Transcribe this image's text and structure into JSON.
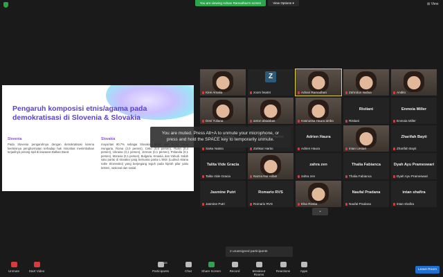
{
  "topbar": {
    "banner": "You are viewing Adnan Ramadhan's screen",
    "view_options": "View Options ▾",
    "view_button": "⊞ View"
  },
  "slide": {
    "title": "Pengaruh komposisi etnis/agama pada demokratisasi di Slovenia & Slovakia",
    "left_heading": "Slovenia",
    "left_text": "Pada Slovenia pengaruhnya dengan demokratisasi karena keetnisnya penghormatan terhadap hak minoritas menimbulkan terjadinya perang sipil di kawasan Balkan Barat.",
    "right_heading": "Slovakia",
    "right_text": "mayoritas 80,7% sebagai Slovakia, terdiri dari 9,7% orang Hungaria, Roma (2,0 persen), Ceko (0,6 persen), Rusin (0,4 persen), Ukraina (0,1 persen), Jerman (0,1 persen), Polandia (0,1 persen), Moravia (0,1 persen), Bulgaria, Kroasia, dan Yahudi. Salah satu partai di slovakia yang bernama partai L'SNS (Ludová strana naše Slovensko) yang berpegang teguh pada kiprah pilar yaitu kristen, nasional dan sosial."
  },
  "participants": [
    {
      "name": "Kirei Amalia",
      "kind": "video"
    },
    {
      "name": "zoom bsa04",
      "kind": "avatar",
      "avatar_letter": "Z"
    },
    {
      "name": "Adnan Ramadhan",
      "kind": "video",
      "active": true
    },
    {
      "name": "Zahrotun Nafisa",
      "kind": "video"
    },
    {
      "name": "Andito",
      "kind": "video"
    },
    {
      "name": "Devi Yuliana",
      "kind": "video"
    },
    {
      "name": "anton abiabbas",
      "kind": "video"
    },
    {
      "name": "Hasnussa Haura ambo",
      "kind": "video"
    },
    {
      "name": "Ristiani",
      "kind": "name"
    },
    {
      "name": "Enmoia Miller",
      "kind": "name"
    },
    {
      "name": "Salsa Nabila",
      "kind": "name"
    },
    {
      "name": "Zulfikar Hartio",
      "kind": "name"
    },
    {
      "name": "Adrien Haura",
      "kind": "name"
    },
    {
      "name": "intan Lestari",
      "kind": "video"
    },
    {
      "name": "Zharifah Bayti",
      "kind": "name"
    },
    {
      "name": "Talita Vide Gracia",
      "kind": "name"
    },
    {
      "name": "Nazza Nur Alifah",
      "kind": "video"
    },
    {
      "name": "zahra zen",
      "kind": "name"
    },
    {
      "name": "Thalia Fabianca",
      "kind": "name"
    },
    {
      "name": "Dyah Ayu Prameswari",
      "kind": "name"
    },
    {
      "name": "Jasmine Putri",
      "kind": "name"
    },
    {
      "name": "Romario RVS",
      "kind": "name"
    },
    {
      "name": "Elsa Rosita",
      "kind": "video"
    },
    {
      "name": "Naufal Pradana",
      "kind": "name"
    },
    {
      "name": "intan shafira",
      "kind": "name"
    }
  ],
  "toast": "You are muted. Press Alt+A to unmute your microphone, or press and hold the SPACE key to temporarily unmute.",
  "unassigned": "2 unassigned participants",
  "toolbar": {
    "unmute": "Unmute",
    "start_video": "Start Video",
    "participants": "Participants",
    "participants_count": "34",
    "chat": "Chat",
    "share_screen": "Share Screen",
    "record": "Record",
    "breakout": "Breakout Rooms",
    "reactions": "Reactions",
    "apps": "Apps",
    "leave": "Leave Room"
  },
  "colors": {
    "accent_green": "#2da44e",
    "leave_blue": "#1f6fd1",
    "slide_title": "#5a3fd0"
  }
}
